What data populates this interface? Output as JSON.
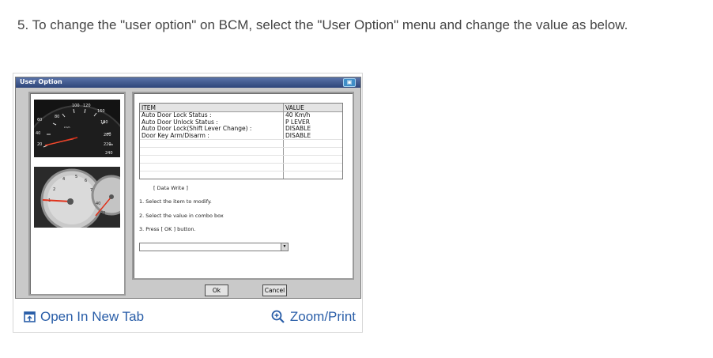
{
  "instruction": "5. To change the \"user option\" on BCM, select the \"User Option\" menu and change the value as below.",
  "dialog": {
    "title": "User Option",
    "table": {
      "headers": {
        "item": "ITEM",
        "value": "VALUE"
      },
      "rows": [
        {
          "item": "Auto Door Lock Status :",
          "value": "40 Km/h"
        },
        {
          "item": "Auto Door Unlock Status :",
          "value": "P LEVER"
        },
        {
          "item": "Auto Door Lock(Shift Lever Change) :",
          "value": "DISABLE"
        },
        {
          "item": "Door Key Arm/Disarm :",
          "value": "DISABLE"
        }
      ]
    },
    "data_write": {
      "heading": "[ Data Write ]",
      "steps": [
        "1. Select the item to modify.",
        "2. Select the value in combo box",
        "3. Press [ OK ] button."
      ]
    },
    "combo_value": "",
    "ok_label": "Ok",
    "cancel_label": "Cancel"
  },
  "footer": {
    "open_tab_label": "Open In New Tab",
    "zoom_label": "Zoom/Print"
  },
  "colors": {
    "link": "#2a5ea8",
    "titlebar": "#2e467a",
    "needle": "#e0321b"
  },
  "icons": [
    "open-new-tab-icon",
    "zoom-icon",
    "window-camera-icon"
  ]
}
